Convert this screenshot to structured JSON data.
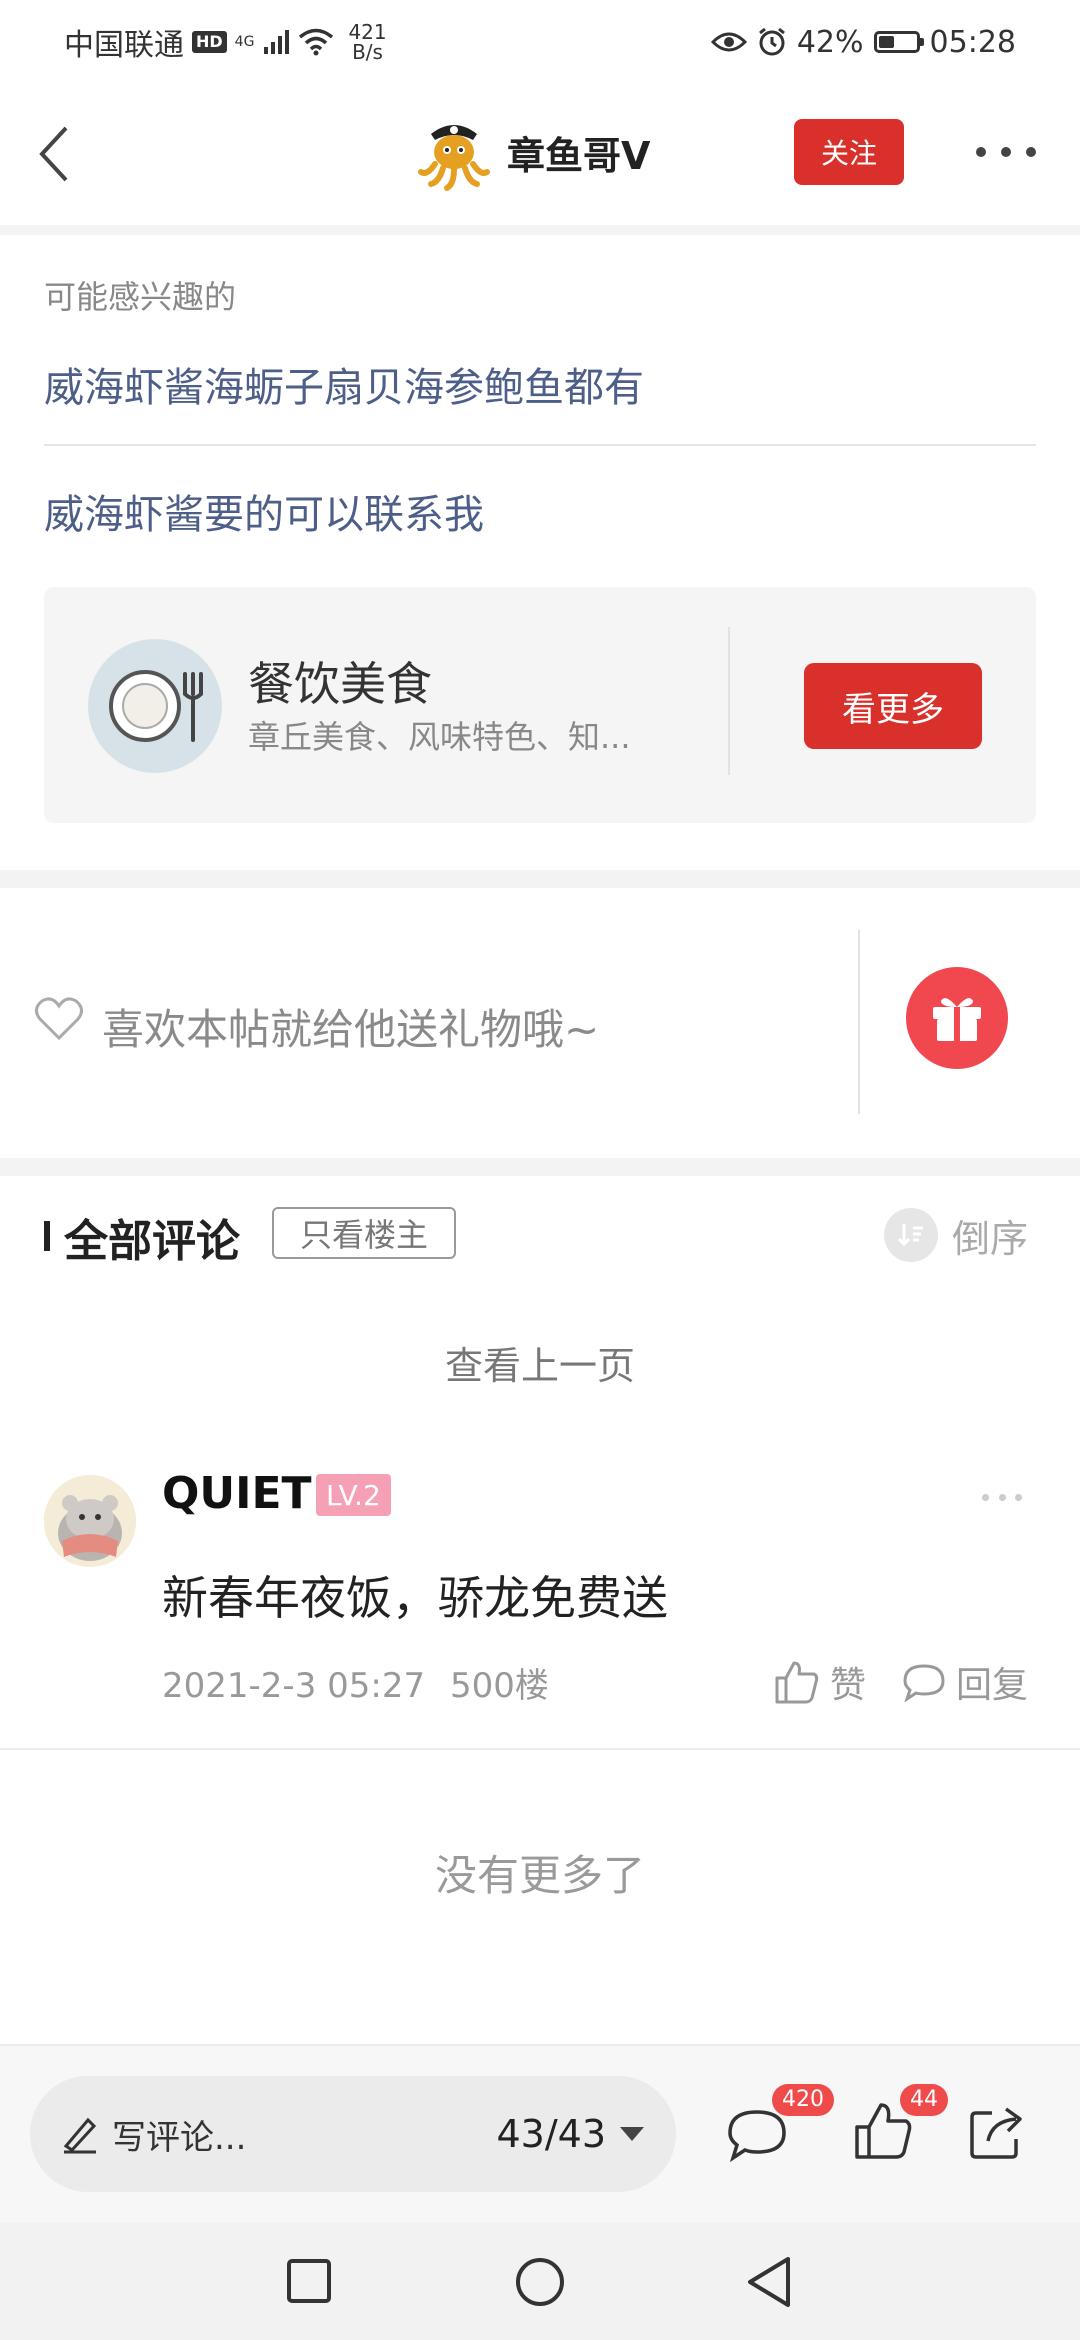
{
  "status_bar": {
    "carrier": "中国联通",
    "hd": "HD",
    "network": "4G",
    "net_speed_value": "421",
    "net_speed_unit": "B/s",
    "battery": "42%",
    "battery_level": 0.42,
    "time": "05:28"
  },
  "header": {
    "author_name": "章鱼哥V",
    "follow_label": "关注"
  },
  "interest": {
    "title": "可能感兴趣的",
    "links": [
      "威海虾酱海蛎子扇贝海参鲍鱼都有",
      "威海虾酱要的可以联系我"
    ]
  },
  "category_card": {
    "title": "餐饮美食",
    "desc": "章丘美食、风味特色、知...",
    "button": "看更多"
  },
  "gift": {
    "text": "喜欢本帖就给他送礼物哦~"
  },
  "comments_header": {
    "title": "全部评论",
    "owner_only": "只看楼主",
    "sort_label": "倒序"
  },
  "prev_page": "查看上一页",
  "comment": {
    "user": "QUIET",
    "level": "LV.2",
    "text": "新春年夜饭，骄龙免费送",
    "timestamp": "2021-2-3 05:27",
    "floor": "500楼",
    "like_label": "赞",
    "reply_label": "回复"
  },
  "no_more": "没有更多了",
  "bottom_bar": {
    "input_placeholder": "写评论...",
    "page_count": "43/43",
    "comments_badge": "420",
    "likes_badge": "44"
  },
  "colors": {
    "accent_red": "#d9302b",
    "link_blue": "#4d5e89",
    "gift_red": "#f1474f",
    "level_pink": "#f6a0b6"
  }
}
